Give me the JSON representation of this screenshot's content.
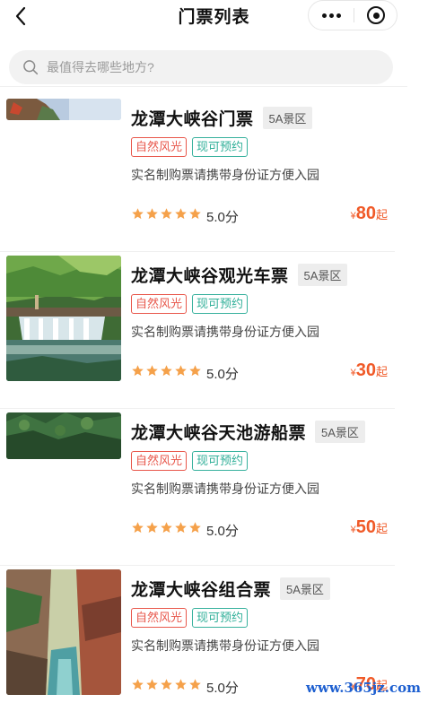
{
  "nav": {
    "title": "门票列表",
    "back_icon": "chevron-left-icon",
    "more_icon": "more-dots-icon",
    "close_icon": "target-close-icon"
  },
  "search": {
    "placeholder": "最值得去哪些地方?",
    "icon": "search-icon"
  },
  "colors": {
    "price": "#f05a28",
    "star": "#f5a14a",
    "tag_red": "#e8574b",
    "tag_green": "#37b19d"
  },
  "items": [
    {
      "title": "龙潭大峡谷门票",
      "level": "5A景区",
      "tags": [
        "自然风光",
        "现可预约"
      ],
      "desc": "实名制购票请携带身份证方便入园",
      "rating_stars": 5,
      "score": "5.0分",
      "currency": "¥",
      "price": "80",
      "price_suffix": "起"
    },
    {
      "title": "龙潭大峡谷观光车票",
      "level": "5A景区",
      "tags": [
        "自然风光",
        "现可预约"
      ],
      "desc": "实名制购票请携带身份证方便入园",
      "rating_stars": 5,
      "score": "5.0分",
      "currency": "¥",
      "price": "30",
      "price_suffix": "起"
    },
    {
      "title": "龙潭大峡谷天池游船票",
      "level": "5A景区",
      "tags": [
        "自然风光",
        "现可预约"
      ],
      "desc": "实名制购票请携带身份证方便入园",
      "rating_stars": 5,
      "score": "5.0分",
      "currency": "¥",
      "price": "50",
      "price_suffix": "起"
    },
    {
      "title": "龙潭大峡谷组合票",
      "level": "5A景区",
      "tags": [
        "自然风光",
        "现可预约"
      ],
      "desc": "实名制购票请携带身份证方便入园",
      "rating_stars": 5,
      "score": "5.0分",
      "currency": "¥",
      "price": "70",
      "price_suffix": "起"
    }
  ],
  "watermark": "www.365jz.com"
}
